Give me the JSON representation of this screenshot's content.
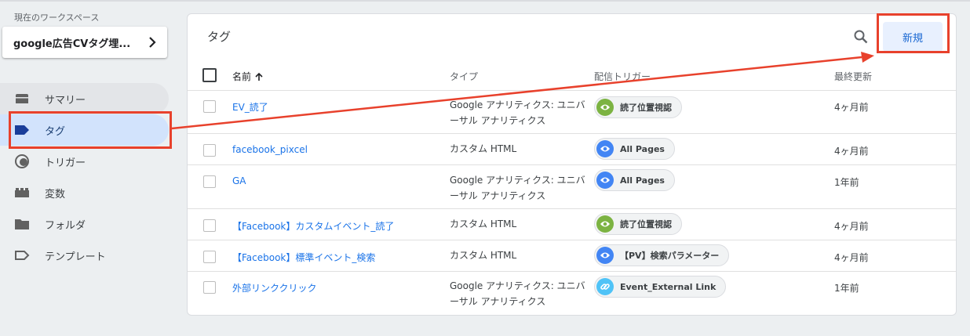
{
  "workspace": {
    "label": "現在のワークスペース",
    "name": "google広告CVタグ埋..."
  },
  "nav": [
    {
      "label": "サマリー",
      "icon": "summary-icon"
    },
    {
      "label": "タグ",
      "icon": "tag-icon"
    },
    {
      "label": "トリガー",
      "icon": "trigger-icon"
    },
    {
      "label": "変数",
      "icon": "variables-icon"
    },
    {
      "label": "フォルダ",
      "icon": "folder-icon"
    },
    {
      "label": "テンプレート",
      "icon": "template-icon"
    }
  ],
  "card": {
    "title": "タグ",
    "new_label": "新規"
  },
  "columns": {
    "name": "名前",
    "type": "タイプ",
    "trigger": "配信トリガー",
    "updated": "最終更新"
  },
  "rows": [
    {
      "name": "EV_読了",
      "type": "Google アナリティクス: ユニバーサル アナリティクス",
      "trigger": "読了位置視認",
      "trigger_icon": "eye-icon",
      "trigger_color": "#7cb342",
      "updated": "4ヶ月前"
    },
    {
      "name": "facebook_pixcel",
      "type": "カスタム HTML",
      "trigger": "All Pages",
      "trigger_icon": "eye-icon",
      "trigger_color": "#4285f4",
      "updated": "4ヶ月前"
    },
    {
      "name": "GA",
      "type": "Google アナリティクス: ユニバーサル アナリティクス",
      "trigger": "All Pages",
      "trigger_icon": "eye-icon",
      "trigger_color": "#4285f4",
      "updated": "1年前"
    },
    {
      "name": "【Facebook】カスタムイベント_読了",
      "type": "カスタム HTML",
      "trigger": "読了位置視認",
      "trigger_icon": "eye-icon",
      "trigger_color": "#7cb342",
      "updated": "4ヶ月前"
    },
    {
      "name": "【Facebook】標準イベント_検索",
      "type": "カスタム HTML",
      "trigger": "【PV】検索パラメーター",
      "trigger_icon": "eye-icon",
      "trigger_color": "#4285f4",
      "updated": "4ヶ月前"
    },
    {
      "name": "外部リンククリック",
      "type": "Google アナリティクス: ユニバーサル アナリティクス",
      "trigger": "Event_External Link",
      "trigger_icon": "link-icon",
      "trigger_color": "#4fc3f7",
      "updated": "1年前"
    }
  ],
  "colors": {
    "accent": "#1a73e8",
    "annotation": "#e8412c",
    "active_nav": "#d2e3fc"
  }
}
